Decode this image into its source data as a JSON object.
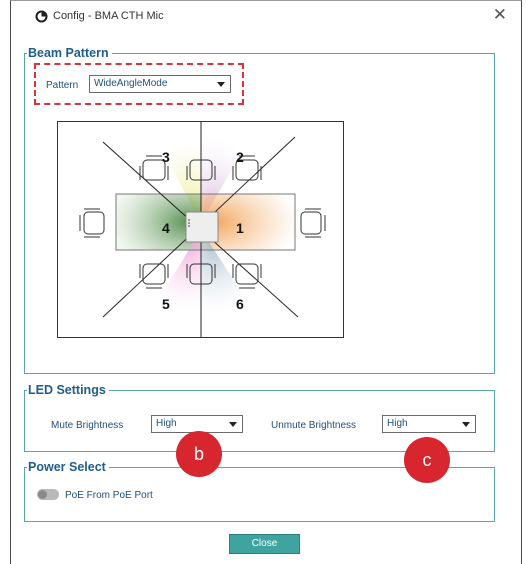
{
  "window": {
    "title": "Config - BMA CTH Mic"
  },
  "beam_pattern": {
    "legend": "Beam Pattern",
    "pattern_label": "Pattern",
    "pattern_value": "WideAngleMode",
    "zones": [
      "1",
      "2",
      "3",
      "4",
      "5",
      "6"
    ],
    "zone_colors": {
      "1": "#f6c28f",
      "2": "#e6d4ea",
      "3": "#f1f0b7",
      "4": "#6a9a62",
      "5": "#f0bfe3",
      "6": "#b9cbd8"
    }
  },
  "led_settings": {
    "legend": "LED Settings",
    "mute_label": "Mute Brightness",
    "mute_value": "High",
    "unmute_label": "Unmute Brightness",
    "unmute_value": "High"
  },
  "power_select": {
    "legend": "Power Select",
    "poe_label": "PoE From PoE Port",
    "poe_enabled": false
  },
  "annotations": {
    "b": "b",
    "c": "c"
  },
  "buttons": {
    "close": "Close"
  },
  "colors": {
    "accent": "#3fa49f",
    "highlight": "#d9343a",
    "badge": "#d7262e",
    "legend_text": "#1f5d8c"
  }
}
